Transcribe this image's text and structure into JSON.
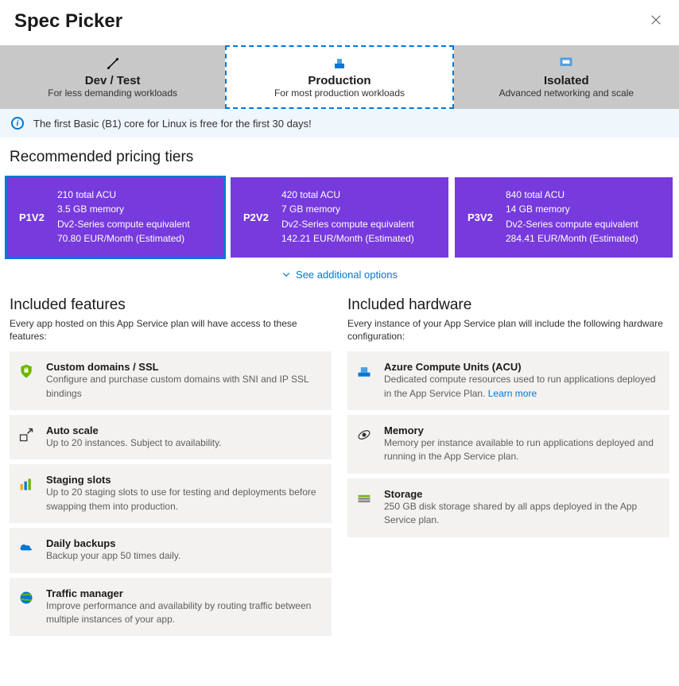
{
  "header": {
    "title": "Spec Picker"
  },
  "tabs": [
    {
      "title": "Dev / Test",
      "subtitle": "For less demanding workloads",
      "selected": false
    },
    {
      "title": "Production",
      "subtitle": "For most production workloads",
      "selected": true
    },
    {
      "title": "Isolated",
      "subtitle": "Advanced networking and scale",
      "selected": false
    }
  ],
  "info": {
    "text": "The first Basic (B1) core for Linux is free for the first 30 days!"
  },
  "recommended": {
    "heading": "Recommended pricing tiers",
    "tiers": [
      {
        "name": "P1V2",
        "specs": [
          "210 total ACU",
          "3.5 GB memory",
          "Dv2-Series compute equivalent",
          "70.80 EUR/Month (Estimated)"
        ],
        "selected": true
      },
      {
        "name": "P2V2",
        "specs": [
          "420 total ACU",
          "7 GB memory",
          "Dv2-Series compute equivalent",
          "142.21 EUR/Month (Estimated)"
        ],
        "selected": false
      },
      {
        "name": "P3V2",
        "specs": [
          "840 total ACU",
          "14 GB memory",
          "Dv2-Series compute equivalent",
          "284.41 EUR/Month (Estimated)"
        ],
        "selected": false
      }
    ],
    "additional": "See additional options"
  },
  "features": {
    "heading": "Included features",
    "description": "Every app hosted on this App Service plan will have access to these features:",
    "items": [
      {
        "title": "Custom domains / SSL",
        "desc": "Configure and purchase custom domains with SNI and IP SSL bindings"
      },
      {
        "title": "Auto scale",
        "desc": "Up to 20 instances. Subject to availability."
      },
      {
        "title": "Staging slots",
        "desc": "Up to 20 staging slots to use for testing and deployments before swapping them into production."
      },
      {
        "title": "Daily backups",
        "desc": "Backup your app 50 times daily."
      },
      {
        "title": "Traffic manager",
        "desc": "Improve performance and availability by routing traffic between multiple instances of your app."
      }
    ]
  },
  "hardware": {
    "heading": "Included hardware",
    "description": "Every instance of your App Service plan will include the following hardware configuration:",
    "items": [
      {
        "title": "Azure Compute Units (ACU)",
        "desc": "Dedicated compute resources used to run applications deployed in the App Service Plan. ",
        "link": "Learn more"
      },
      {
        "title": "Memory",
        "desc": "Memory per instance available to run applications deployed and running in the App Service plan."
      },
      {
        "title": "Storage",
        "desc": "250 GB disk storage shared by all apps deployed in the App Service plan."
      }
    ]
  }
}
